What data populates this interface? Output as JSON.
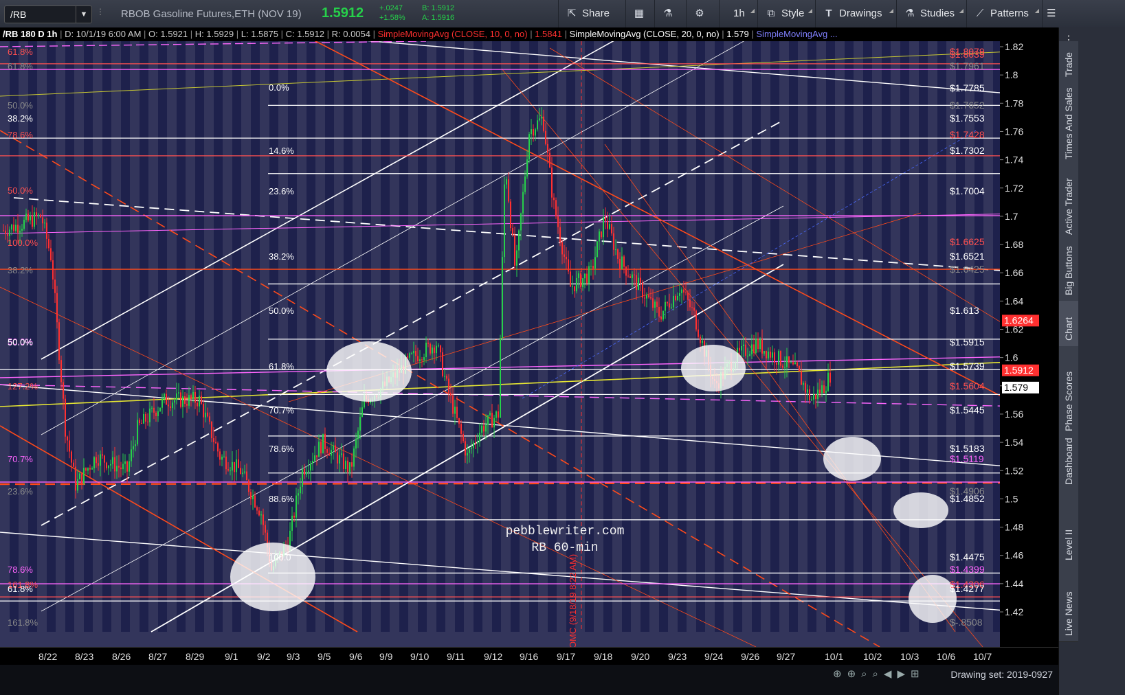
{
  "toolbar": {
    "symbol": "/RB",
    "description": "RBOB Gasoline Futures,ETH (NOV 19)",
    "last": "1.5912",
    "change": "+.0247",
    "change_pct": "+1.58%",
    "bid": "B: 1.5912",
    "ask": "A: 1.5916",
    "buttons": {
      "share": "Share",
      "timeframe": "1h",
      "style": "Style",
      "drawings": "Drawings",
      "studies": "Studies",
      "patterns": "Patterns"
    }
  },
  "infobar": {
    "header": "/RB 180 D 1h",
    "date": "D: 10/1/19 6:00 AM",
    "open": "O: 1.5921",
    "high": "H: 1.5929",
    "low": "L: 1.5875",
    "close": "C: 1.5912",
    "range": "R: 0.0054",
    "sma10": "SimpleMovingAvg (CLOSE, 10, 0, no)",
    "sma10_val": "1.5841",
    "sma20": "SimpleMovingAvg (CLOSE, 20, 0, no)",
    "sma20_val": "1.579",
    "sma_more": "SimpleMovingAvg ..."
  },
  "price_axis": [
    "1.82",
    "1.8",
    "1.78",
    "1.76",
    "1.74",
    "1.72",
    "1.7",
    "1.68",
    "1.66",
    "1.64",
    "1.62",
    "1.6",
    "1.58",
    "1.56",
    "1.54",
    "1.52",
    "1.5",
    "1.48",
    "1.46",
    "1.44",
    "1.42"
  ],
  "price_flags": {
    "red": "1.6264",
    "last_red": "1.5912",
    "white": "1.579"
  },
  "level_labels": [
    {
      "text": "$1.8039",
      "color": "#ff5050"
    },
    {
      "text": "$1.8079",
      "color": "#ff5050"
    },
    {
      "text": "$1.7961",
      "color": "#8a8a8a"
    },
    {
      "text": "$1.7785",
      "color": "#ffffff"
    },
    {
      "text": "$1.7652",
      "color": "#8a8a8a"
    },
    {
      "text": "$1.7553",
      "color": "#ffffff"
    },
    {
      "text": "$1.7428",
      "color": "#ff5050"
    },
    {
      "text": "$1.7302",
      "color": "#ffffff"
    },
    {
      "text": "$1.7004",
      "color": "#ffffff"
    },
    {
      "text": "$1.6625",
      "color": "#ff5050"
    },
    {
      "text": "$1.6521",
      "color": "#ffffff"
    },
    {
      "text": "$1.6425",
      "color": "#8a8a8a"
    },
    {
      "text": "$1.613",
      "color": "#ffffff"
    },
    {
      "text": "$1.5915",
      "color": "#ffffff"
    },
    {
      "text": "$1.5739",
      "color": "#ffffff"
    },
    {
      "text": "$1.5604",
      "color": "#ff5050"
    },
    {
      "text": "$1.5445",
      "color": "#ffffff"
    },
    {
      "text": "$1.5183",
      "color": "#ffffff"
    },
    {
      "text": "$1.5119",
      "color": "#ff66ff"
    },
    {
      "text": "$1.4906",
      "color": "#8a8a8a"
    },
    {
      "text": "$1.4852",
      "color": "#ffffff"
    },
    {
      "text": "$1.4475",
      "color": "#ffffff"
    },
    {
      "text": "$1.4399",
      "color": "#ff66ff"
    },
    {
      "text": "$1.4306",
      "color": "#ff5050"
    },
    {
      "text": "$1.4277",
      "color": "#ffffff"
    },
    {
      "text": "$-.8508",
      "color": "#8a8a8a"
    }
  ],
  "fib_mid": [
    "0.0%",
    "14.6%",
    "23.6%",
    "38.2%",
    "50.0%",
    "61.8%",
    "70.7%",
    "78.6%",
    "88.6%",
    "100.0"
  ],
  "fib_left": [
    {
      "text": "61.8%",
      "color": "#ff5050"
    },
    {
      "text": "61.8%",
      "color": "#8a8a8a"
    },
    {
      "text": "50.0%",
      "color": "#8a8a8a"
    },
    {
      "text": "38.2%",
      "color": "#ffffff"
    },
    {
      "text": "78.6%",
      "color": "#ff5050"
    },
    {
      "text": "50.0%",
      "color": "#ff5050"
    },
    {
      "text": "100.0%",
      "color": "#ff5050"
    },
    {
      "text": "38.2%",
      "color": "#8a8a8a"
    },
    {
      "text": "50.0%",
      "color": "#ff66ff"
    },
    {
      "text": "50.0%",
      "color": "#ffffff"
    },
    {
      "text": "127.2%",
      "color": "#ff5050"
    },
    {
      "text": "70.7%",
      "color": "#ff66ff"
    },
    {
      "text": "23.6%",
      "color": "#8a8a8a"
    },
    {
      "text": "78.6%",
      "color": "#ff66ff"
    },
    {
      "text": "161.8%",
      "color": "#ff5050"
    },
    {
      "text": "61.8%",
      "color": "#ffffff"
    },
    {
      "text": "161.8%",
      "color": "#8a8a8a"
    }
  ],
  "dates": [
    "8/22",
    "8/23",
    "8/26",
    "8/27",
    "8/29",
    "9/1",
    "9/2",
    "9/3",
    "9/5",
    "9/6",
    "9/9",
    "9/10",
    "9/11",
    "9/12",
    "9/16",
    "9/17",
    "9/18",
    "9/20",
    "9/23",
    "9/24",
    "9/26",
    "9/27",
    "10/1",
    "10/2",
    "10/3",
    "10/6",
    "10/7"
  ],
  "watermark": {
    "line1": "pebblewriter.com",
    "line2": "RB 60-min"
  },
  "fomc": "FOMC (9/18/19 8:22 AM)",
  "drawing_set": "Drawing set: 2019-0927",
  "sidebar": [
    "Trade",
    "Times And Sales",
    "Active Trader",
    "Big Buttons",
    "Chart",
    "Phase Scores",
    "Dashboard",
    "Level II",
    "Live News"
  ],
  "colors": {
    "sma10": "#ffffff",
    "sma20": "#ffff33",
    "sma50": "#8080ff",
    "sma200": "#ff4a1a",
    "up": "#26d04a",
    "down": "#ff3030"
  }
}
